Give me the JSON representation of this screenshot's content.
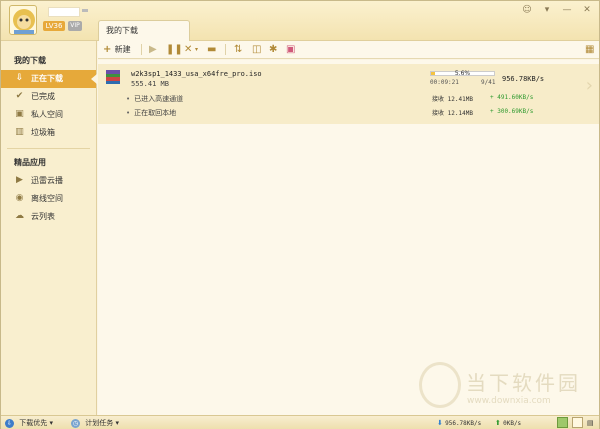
{
  "header": {
    "level": "LV36",
    "vip": "VIP",
    "window_controls": [
      "☺",
      "▾",
      "—",
      "✕"
    ]
  },
  "tab": {
    "label": "我的下载"
  },
  "sidebar": {
    "my_downloads": "我的下载",
    "items": [
      {
        "label": "正在下载",
        "icon": "download-icon"
      },
      {
        "label": "已完成",
        "icon": "checkmark-icon"
      },
      {
        "label": "私人空间",
        "icon": "private-space-icon"
      },
      {
        "label": "垃圾箱",
        "icon": "trash-icon"
      }
    ],
    "apps_heading": "精品应用",
    "apps": [
      {
        "label": "迅雷云播",
        "icon": "cloud-play-icon"
      },
      {
        "label": "离线空间",
        "icon": "offline-space-icon"
      },
      {
        "label": "云列表",
        "icon": "cloud-list-icon"
      }
    ]
  },
  "toolbar": {
    "new_label": "新建"
  },
  "task": {
    "filename": "w2k3sp1_1433_usa_x64fre_pro.iso",
    "size": "555.41 MB",
    "progress_percent": 5.6,
    "progress_text": "5.6%",
    "elapsed": "00:09:21",
    "peers": "9/41",
    "total_speed": "956.78KB/s",
    "sub_rows": [
      {
        "label": "已进入高速通道",
        "recv_label": "接收",
        "recv_size": "12.41MB",
        "speed": "+ 491.60KB/s"
      },
      {
        "label": "正在取回本地",
        "recv_label": "接收",
        "recv_size": "12.14MB",
        "speed": "+ 300.69KB/s"
      }
    ]
  },
  "watermark": {
    "cn": "当下软件园",
    "url": "www.downxia.com"
  },
  "statusbar": {
    "priority": "下载优先",
    "schedule": "计划任务",
    "down_speed": "956.78KB/s",
    "up_speed": "0KB/s"
  },
  "colors": {
    "accent": "#e6a93a",
    "sidebar_bg": "#f9efcf",
    "content_bg": "#fdf8ea",
    "task_row_bg": "#f7ecc9",
    "speed_green": "#2f9a2f"
  }
}
